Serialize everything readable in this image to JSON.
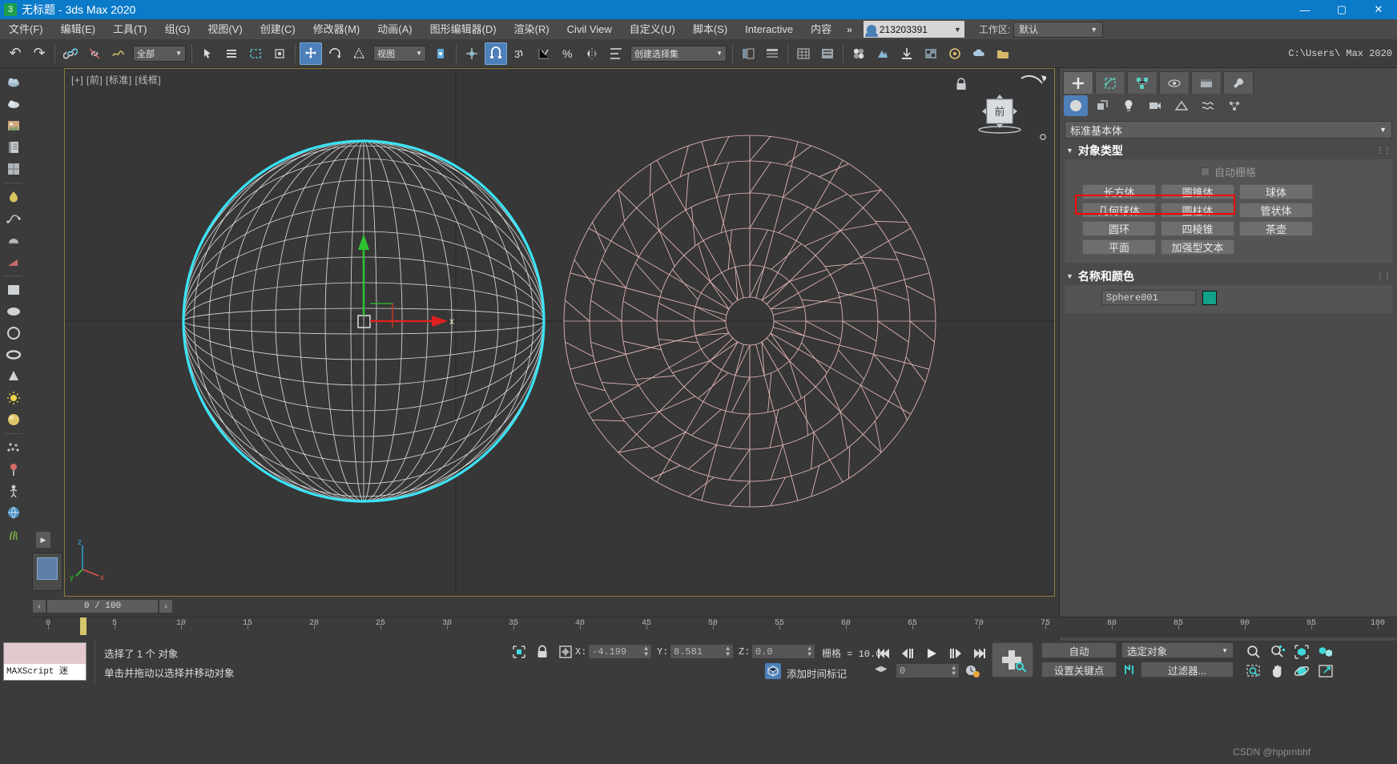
{
  "window": {
    "title": "无标题 - 3ds Max 2020",
    "logo_text": "3",
    "minimize": "—",
    "maximize": "▢",
    "close": "✕"
  },
  "menu": {
    "items": [
      "文件(F)",
      "编辑(E)",
      "工具(T)",
      "组(G)",
      "视图(V)",
      "创建(C)",
      "修改器(M)",
      "动画(A)",
      "图形编辑器(D)",
      "渲染(R)",
      "Civil View",
      "自定义(U)",
      "脚本(S)",
      "Interactive",
      "内容"
    ],
    "overflow": "»",
    "account": "213203391",
    "workspace_label": "工作区:",
    "workspace_value": "默认",
    "caret": "▼"
  },
  "toolbar": {
    "undo": "↶",
    "redo": "↷",
    "select_filter": "全部",
    "select_filter_caret": "▼",
    "view_coord": "视图",
    "view_coord_caret": "▼",
    "named_set": "创建选择集",
    "named_set_caret": "▼",
    "path": "C:\\Users\\ Max 2020"
  },
  "viewport": {
    "label": "[+] [前] [标准] [线框]",
    "viewcube_text": "前",
    "axis_x": "x",
    "axis_y": "y",
    "axis_z": "z",
    "selected_object_color": "#33e0f0",
    "unselected_object_color": "#e8b6b6"
  },
  "command_panel": {
    "tabs": [
      "create-tab",
      "modify-tab",
      "hierarchy-tab",
      "motion-tab",
      "display-tab",
      "utilities-tab"
    ],
    "tab_glyphs": [
      "✛",
      "◱",
      "⊞",
      "◎",
      "▭",
      "🔧"
    ],
    "subtabs": [
      "geometry",
      "shapes",
      "lights",
      "cameras",
      "helpers",
      "space-warps",
      "systems"
    ],
    "category": "标准基本体",
    "category_caret": "▼",
    "object_type": {
      "title": "对象类型",
      "autogrid": "自动栅格",
      "buttons": [
        "长方体",
        "圆锥体",
        "球体",
        "几何球体",
        "圆柱体",
        "管状体",
        "圆环",
        "四棱锥",
        "茶壶",
        "平面",
        "加强型文本"
      ],
      "highlighted": [
        "球体",
        "几何球体"
      ],
      "highlight_color": "#ff0000"
    },
    "name_and_color": {
      "title": "名称和颜色",
      "name": "Sphere001",
      "color": "#12a18a"
    },
    "tri": "▼",
    "grip": "⋮⋮"
  },
  "timeline": {
    "prev": "‹",
    "next": "›",
    "frame_display": "0 / 100",
    "ruler_labels": [
      "0",
      "5",
      "10",
      "15",
      "20",
      "25",
      "30",
      "35",
      "40",
      "45",
      "50",
      "55",
      "60",
      "65",
      "70",
      "75",
      "80",
      "85",
      "90",
      "95",
      "100"
    ]
  },
  "status": {
    "listener_label": "MAXScript 迷",
    "selection_text": "选择了 1 个 对象",
    "prompt_text": "单击并拖动以选择并移动对象",
    "coord_x_label": "X:",
    "coord_x": "-4.199",
    "coord_y_label": "Y:",
    "coord_y": "8.581",
    "coord_z_label": "Z:",
    "coord_z": "0.0",
    "grid_label": "栅格 = 10.0",
    "add_time_tag": "添加时间标记",
    "key_frame_value": "0",
    "auto_key": "自动",
    "set_key": "设置关键点",
    "key_filter_select": "选定对象",
    "key_filter_caret": "▼",
    "filters_btn": "过滤器...",
    "spinner": "⇕",
    "watermark": "CSDN @hpprnbhf"
  }
}
